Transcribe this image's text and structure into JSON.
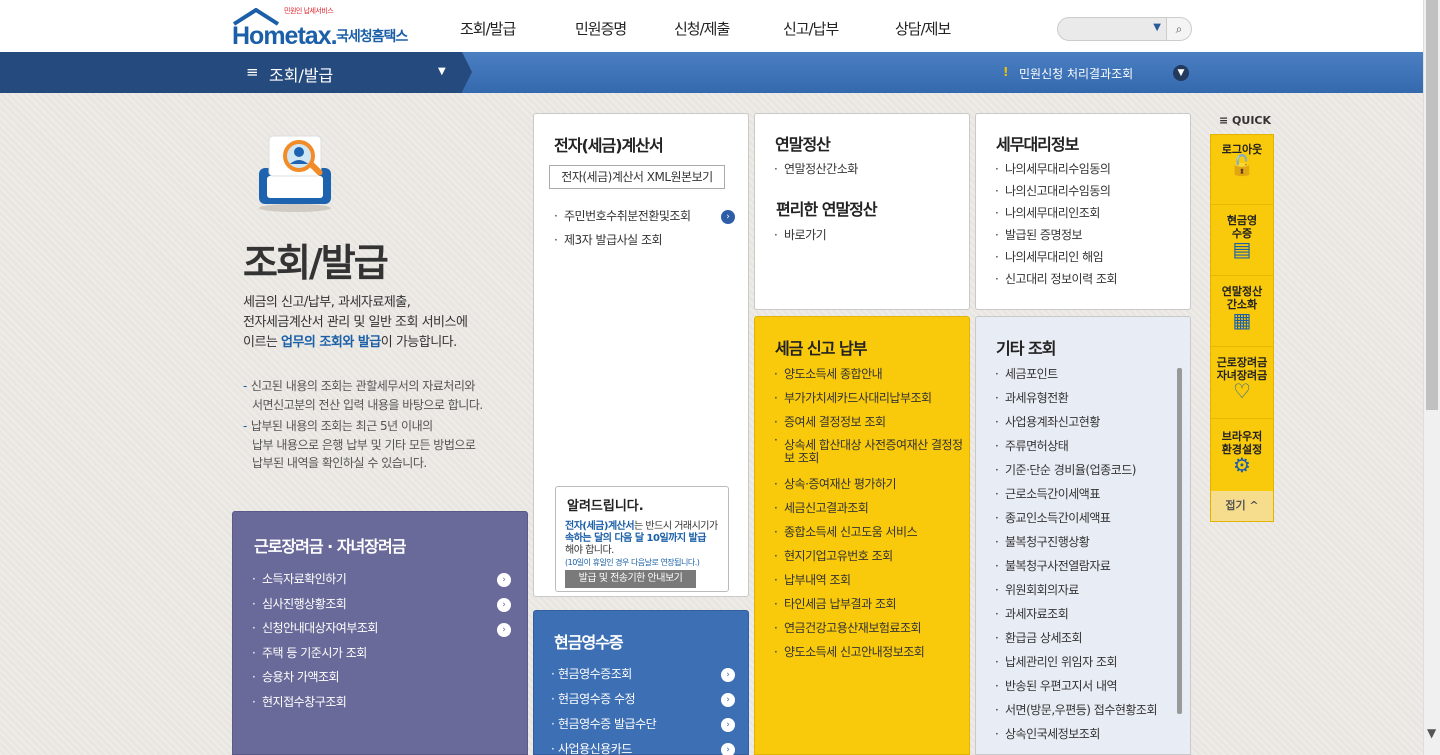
{
  "header": {
    "logo_small": "민원인 납세서비스",
    "logo_brand": "Hometax.",
    "logo_kor": "국세청홈택스",
    "nav": [
      "조회/발급",
      "민원증명",
      "신청/제출",
      "신고/납부",
      "상담/제보"
    ],
    "search_placeholder": ""
  },
  "subbar": {
    "title": "조회/발급",
    "link": "민원신청 처리결과조회"
  },
  "hero": {
    "title": "조회/발급",
    "desc1": "세금의 신고/납부, 과세자료제출,",
    "desc2": "전자세금계산서 관리 및 일반 조회 서비스에",
    "desc3_pre": "이르는 ",
    "desc3_hl": "업무의 조회와 발급",
    "desc3_post": "이 가능합니다.",
    "note1": [
      "신고된 내용의 조회는 관할세무서의 자료처리와",
      "서면신고분의 전산 입력 내용을 바탕으로 합니다."
    ],
    "note2": [
      "납부된 내용의 조회는 최근 5년 이내의",
      "납부 내용으로 은행 납부 및 기타 모든 방법으로",
      "납부된 내역을 확인하실 수 있습니다."
    ]
  },
  "etax": {
    "title": "전자(세금)계산서",
    "xml_button": "전자(세금)계산서 XML원본보기",
    "items": [
      "주민번호수취분전환및조회",
      "제3자 발급사실 조회"
    ]
  },
  "notice": {
    "title": "알려드립니다.",
    "body_hl": "전자(세금)계산서",
    "body1": "는 반드시 거래시기가",
    "body2_hl": "속하는 달의 다음 달 10일까지 발급",
    "body3": "해야 합니다.",
    "small": "(10일이 휴일인 경우 다음날로 연장됩니다.)",
    "button": "발급 및 전송기한 안내보기"
  },
  "yearend": {
    "title": "연말정산",
    "items": [
      "연말정산간소화"
    ],
    "title2": "편리한 연말정산",
    "items2": [
      "바로가기"
    ]
  },
  "agent": {
    "title": "세무대리정보",
    "items": [
      "나의세무대리수임동의",
      "나의신고대리수임동의",
      "나의세무대리인조회",
      "발급된 증명정보",
      "나의세무대리인 해임",
      "신고대리 정보이력 조회"
    ]
  },
  "incentive": {
    "title": "근로장려금 · 자녀장려금",
    "items": [
      "소득자료확인하기",
      "심사진행상황조회",
      "신청안내대상자여부조회",
      "주택 등 기준시가 조회",
      "승용차 가액조회",
      "현지접수창구조회"
    ]
  },
  "cash": {
    "title": "현금영수증",
    "items": [
      "현금영수증조회",
      "현금영수증 수정",
      "현금영수증 발급수단",
      "사업용신용카드"
    ]
  },
  "taxpay": {
    "title": "세금 신고 납부",
    "items": [
      "양도소득세 종합안내",
      "부가가치세카드사대리납부조회",
      "증여세 결정정보 조회",
      "상속세 합산대상 사전증여재산 결정정보 조회",
      "상속·증여재산 평가하기",
      "세금신고결과조회",
      "종합소득세 신고도움 서비스",
      "현지기업고유번호 조회",
      "납부내역 조회",
      "타인세금 납부결과 조회",
      "연금건강고용산재보험료조회",
      "양도소득세 신고안내정보조회"
    ]
  },
  "etc": {
    "title": "기타 조회",
    "items": [
      "세금포인트",
      "과세유형전환",
      "사업용계좌신고현황",
      "주류면허상태",
      "기준·단순 경비율(업종코드)",
      "근로소득간이세액표",
      "종교인소득간이세액표",
      "불복청구진행상황",
      "불복청구사전열람자료",
      "위원회회의자료",
      "과세자료조회",
      "환급금 상세조회",
      "납세관리인 위임자 조회",
      "반송된 우편고지서 내역",
      "서면(방문,우편등) 접수현황조회",
      "상속인국세정보조회"
    ]
  },
  "quick": {
    "label": "QUICK",
    "items": [
      "로그아웃",
      "현금영수증",
      "연말정산간소화",
      "근로장려금자녀장려금",
      "브라우저환경설정"
    ],
    "fold": "접기"
  },
  "colors": {
    "primary_blue": "#1a5fa8",
    "yellow": "#f9c90b",
    "purple": "#6a6a9a",
    "navy": "#254a7e"
  }
}
